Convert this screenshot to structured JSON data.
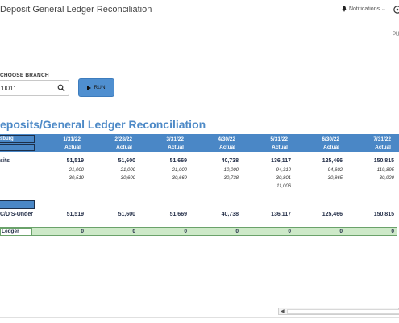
{
  "app": {
    "title": "Deposit General Ledger Reconciliation",
    "notifications_label": "Notifications",
    "side_label": "PU"
  },
  "filters": {
    "branch_label": "CHOOSE BRANCH",
    "branch_value": "'001'",
    "run_label": "RUN"
  },
  "report": {
    "title": "eposits/General Ledger Reconciliation",
    "branch_header": "sburg",
    "columns": [
      {
        "date": "1/31/22",
        "type": "Actual"
      },
      {
        "date": "2/28/22",
        "type": "Actual"
      },
      {
        "date": "3/31/22",
        "type": "Actual"
      },
      {
        "date": "4/30/22",
        "type": "Actual"
      },
      {
        "date": "5/31/22",
        "type": "Actual"
      },
      {
        "date": "6/30/22",
        "type": "Actual"
      },
      {
        "date": "7/31/22",
        "type": "Actual"
      }
    ],
    "rows": {
      "deposits_label": "sits",
      "deposits": [
        "51,519",
        "51,600",
        "51,669",
        "40,738",
        "136,117",
        "125,466",
        "150,815"
      ],
      "sub1": [
        "21,000",
        "21,000",
        "21,000",
        "10,000",
        "94,310",
        "94,602",
        "119,895"
      ],
      "sub2": [
        "30,519",
        "30,600",
        "30,669",
        "30,738",
        "30,801",
        "30,865",
        "30,920"
      ],
      "sub3": [
        "",
        "",
        "",
        "",
        "11,006",
        "",
        ""
      ],
      "under_label": "C/D'S-Under",
      "under": [
        "51,519",
        "51,600",
        "51,669",
        "40,738",
        "136,117",
        "125,466",
        "150,815"
      ],
      "ledger_label": "Ledger",
      "ledger": [
        "0",
        "0",
        "0",
        "0",
        "0",
        "0",
        "0"
      ]
    }
  },
  "colors": {
    "header_blue": "#4a87c6",
    "title_blue": "#4e8ac7",
    "green_row": "#cde9c8",
    "run_button": "#4f8fd0"
  }
}
